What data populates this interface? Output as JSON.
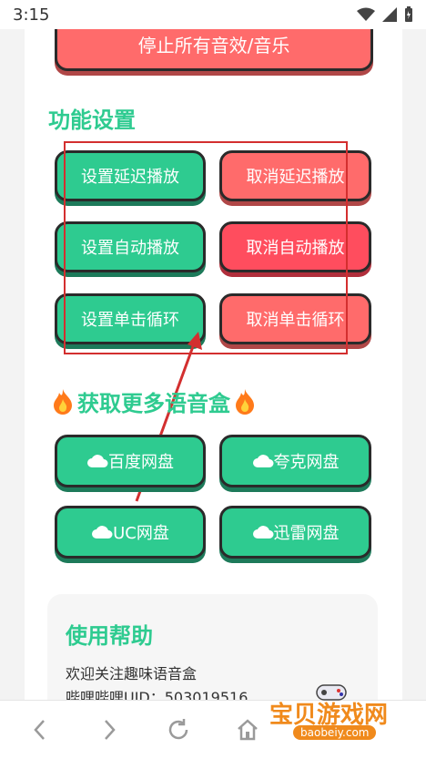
{
  "status": {
    "time": "3:15"
  },
  "buttons": {
    "stop_all": "停止所有音效/音乐",
    "set_delay": "设置延迟播放",
    "cancel_delay": "取消延迟播放",
    "set_auto": "设置自动播放",
    "cancel_auto": "取消自动播放",
    "set_loop": "设置单击循环",
    "cancel_loop": "取消单击循环"
  },
  "sections": {
    "function_settings": "功能设置",
    "get_more": "获取更多语音盒"
  },
  "downloads": {
    "baidu": "百度网盘",
    "quark": "夸克网盘",
    "uc": "UC网盘",
    "xunlei": "迅雷网盘"
  },
  "help": {
    "title": "使用帮助",
    "line1": "欢迎关注趣味语音盒",
    "line2": "哔哩哔哩UID：503019516"
  },
  "watermark": {
    "brand": "宝贝游戏网",
    "domain": "baobeiy.com"
  },
  "icons": {
    "fire": "fire-icon",
    "cloud": "cloud-icon",
    "back": "chevron-left-icon",
    "forward": "chevron-right-icon",
    "reload": "reload-icon",
    "home": "home-icon"
  },
  "colors": {
    "green": "#2ecb90",
    "red": "#ff6b6b",
    "annotation": "#d32f2f"
  }
}
